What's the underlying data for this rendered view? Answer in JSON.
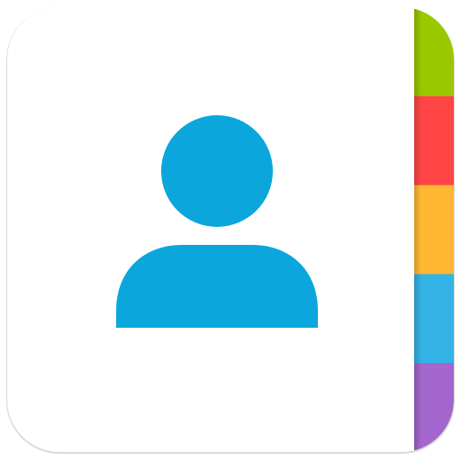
{
  "icon": {
    "name": "contacts-app-icon",
    "symbol": "person-icon",
    "colors": {
      "page": "#ffffff",
      "shadow": "#d9d9d9",
      "person": "#0aa6dc",
      "spine_shadow": "#6b6b6b"
    },
    "tabs": [
      {
        "name": "tab-green",
        "color": "#99c700"
      },
      {
        "name": "tab-red",
        "color": "#ff4545"
      },
      {
        "name": "tab-yellow",
        "color": "#ffb833"
      },
      {
        "name": "tab-blue",
        "color": "#33b3e6"
      },
      {
        "name": "tab-purple",
        "color": "#a366cc"
      }
    ]
  }
}
